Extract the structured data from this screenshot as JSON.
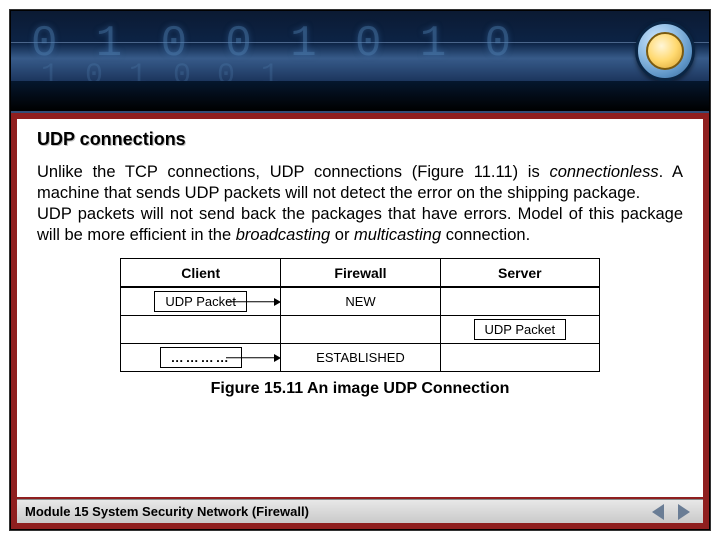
{
  "banner": {
    "digits_top": "0 1 0 0 1 0 1 0",
    "digits_mid": "1 0 1 0 0 1"
  },
  "title": "UDP connections",
  "paragraph": {
    "p1_a": "Unlike the TCP connections, UDP connections (Figure 11.11) is ",
    "p1_italic1": "connectionless",
    "p1_b": ". A machine that sends UDP packets will not detect the error on the shipping package.",
    "p2_a": "UDP packets will not send back the packages that have errors. Model of this package will be more efficient in the ",
    "p2_italic1": "broadcasting",
    "p2_b": " or ",
    "p2_italic2": "multicasting",
    "p2_c": " connection."
  },
  "diagram": {
    "headers": {
      "c1": "Client",
      "c2": "Firewall",
      "c3": "Server"
    },
    "row1": {
      "client": "UDP Packet",
      "firewall": "NEW",
      "server": ""
    },
    "row2": {
      "client": "",
      "firewall": "",
      "server": "UDP Packet"
    },
    "row3": {
      "client": "…………",
      "firewall": "ESTABLISHED",
      "server": ""
    }
  },
  "caption": "Figure 15.11 An image UDP Connection",
  "footer": {
    "module": "Module 15 System Security Network (Firewall)"
  }
}
